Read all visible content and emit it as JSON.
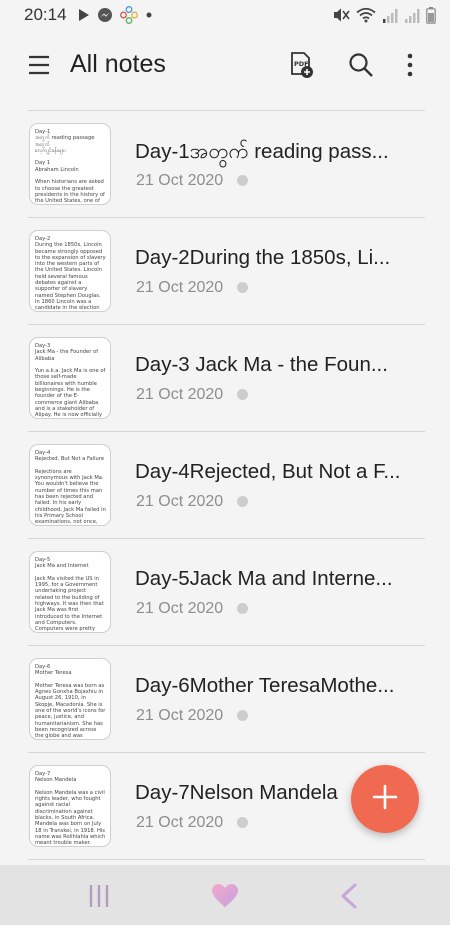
{
  "status_bar": {
    "time": "20:14",
    "left_icons": [
      "play-store-icon",
      "messenger-icon",
      "flower-icon",
      "dot-icon"
    ],
    "right_icons": [
      "mute-icon",
      "wifi-icon",
      "signal-icon",
      "signal-icon",
      "battery-icon"
    ]
  },
  "header": {
    "title": "All notes",
    "menu_icon": "hamburger-icon",
    "pdf_icon": "pdf-add-icon",
    "search_icon": "search-icon",
    "more_icon": "more-vertical-icon"
  },
  "notes": [
    {
      "title": "Day-1အတွက် reading pass...",
      "date": "21 Oct 2020",
      "preview": "Day-1\nအတွက် reading passage အတွက်\nလေ့ကျင့်ခန်းများ\n\nDay 1\nAbraham Lincoln\n\nWhen historians are asked to choose the greatest presidents in the history of the United States, one of the names"
    },
    {
      "title": "Day-2During the 1850s, Li...",
      "date": "21 Oct 2020",
      "preview": "Day-2\nDuring the 1850s, Lincoln became strongly opposed to the expansion of slavery into the western parts of the United States. Lincoln held several famous debates against a supporter of slavery named Stephen Douglas. In 1860 Lincoln was a candidate in the election for President of the United States."
    },
    {
      "title": "Day-3  Jack Ma - the Foun...",
      "date": "21 Oct 2020",
      "preview": "Day-3\n  Jack Ma - the Founder of Alibaba\n\n   Yun a.k.a. Jack Ma is one of those self-made billionaires with humble beginnings. He is the founder of the E-commerce giant Alibaba and is a stakeholder of Alipay. He is now officially the richest man in China with an estimated net"
    },
    {
      "title": "Day-4Rejected, But Not a F...",
      "date": "21 Oct 2020",
      "preview": "Day-4\nRejected, But Not a Failure\n\n   Rejections are synonymous with Jack Ma. You wouldn't believe the number of times this man has been rejected and failed. In his early childhood, Jack Ma failed in his Primary School examinations, not once, but twice! He failed three times in"
    },
    {
      "title": "Day-5Jack Ma and Interne...",
      "date": "21 Oct 2020",
      "preview": "Day-5\nJack Ma and Internet\n\n   Jack Ma visited the US in 1995, for a Government undertaking project related to the building of highways. It was then that Jack Ma was first introduced to the Internet and Computers. Computers were pretty rare in China then, given the high costs associated with"
    },
    {
      "title": "Day-6Mother TeresaMothe...",
      "date": "21 Oct 2020",
      "preview": "Day-6\nMother Teresa\n\nMother Teresa was born as Agnes Gonxha Bojaxhiu in August 26, 1910, in Skopje, Macedonia. She is one of the world's icons for peace, justice, and humanitarianism. She has been recognized across the globe and was awarded the Nobel Peace Prize for her"
    },
    {
      "title": "Day-7Nelson Mandela",
      "date": "21 Oct 2020",
      "preview": "Day-7\nNelson Mandela\n\nNelson Mandela was a civil rights leader, who fought against racial discrimination against blacks, in South Africa. Mandela was born on July 18 in Transkei, in 1918. His name was Rolihlahla which meant trouble maker. When Mandela was nine years old, he"
    }
  ],
  "fab_icon": "plus-icon",
  "nav_bar": {
    "recents_icon": "recents-icon",
    "home_icon": "heart-home-icon",
    "back_icon": "back-chevron-icon"
  },
  "colors": {
    "background": "#f4f4f4",
    "fab": "#f06a52",
    "nav_bar": "#e3e3e3",
    "date_text": "#8e8e8e"
  }
}
